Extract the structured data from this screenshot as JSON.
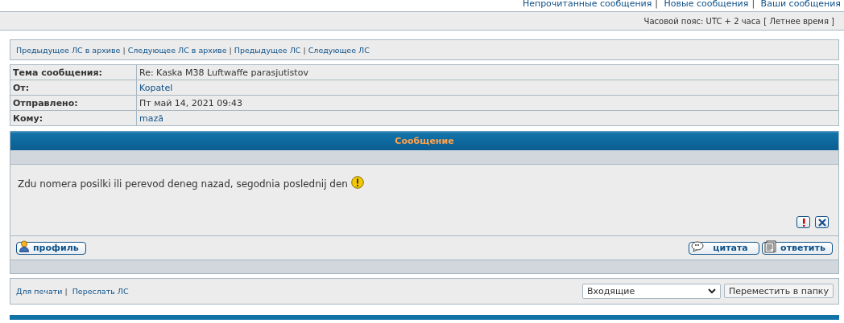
{
  "top_links": [
    "Непрочитанные сообщения",
    "Новые сообщения",
    "Ваши сообщения"
  ],
  "separator": "|",
  "timezone": {
    "label": "Часовой пояс: UTC + 2 часа",
    "dst": "[ Летнее время ]"
  },
  "nav_links": [
    "Предыдущее ЛС в архиве",
    "Следующее ЛС в архиве",
    "Предыдущее ЛС",
    "Следующее ЛС"
  ],
  "header_rows": [
    {
      "label": "Тема сообщения:",
      "value": "Re: Kaska M38 Luftwaffe parasjutistov",
      "kind": "text"
    },
    {
      "label": "От:",
      "value": "Kopatel",
      "kind": "link"
    },
    {
      "label": "Отправлено:",
      "value": "Пт май 14, 2021 09:43",
      "kind": "text"
    },
    {
      "label": "Кому:",
      "value": "mazā",
      "kind": "link"
    }
  ],
  "message": {
    "title": "Сообщение",
    "body": "Zdu nomera posilki ili perevod deneg nazad, segodnia poslednij den"
  },
  "buttons": {
    "profile": "профиль",
    "quote": "цитата",
    "reply": "ответить"
  },
  "bottom_links": [
    "Для печати",
    "Переслать ЛС"
  ],
  "folder": {
    "value": "Входящие",
    "button": "Переместить в папку"
  }
}
